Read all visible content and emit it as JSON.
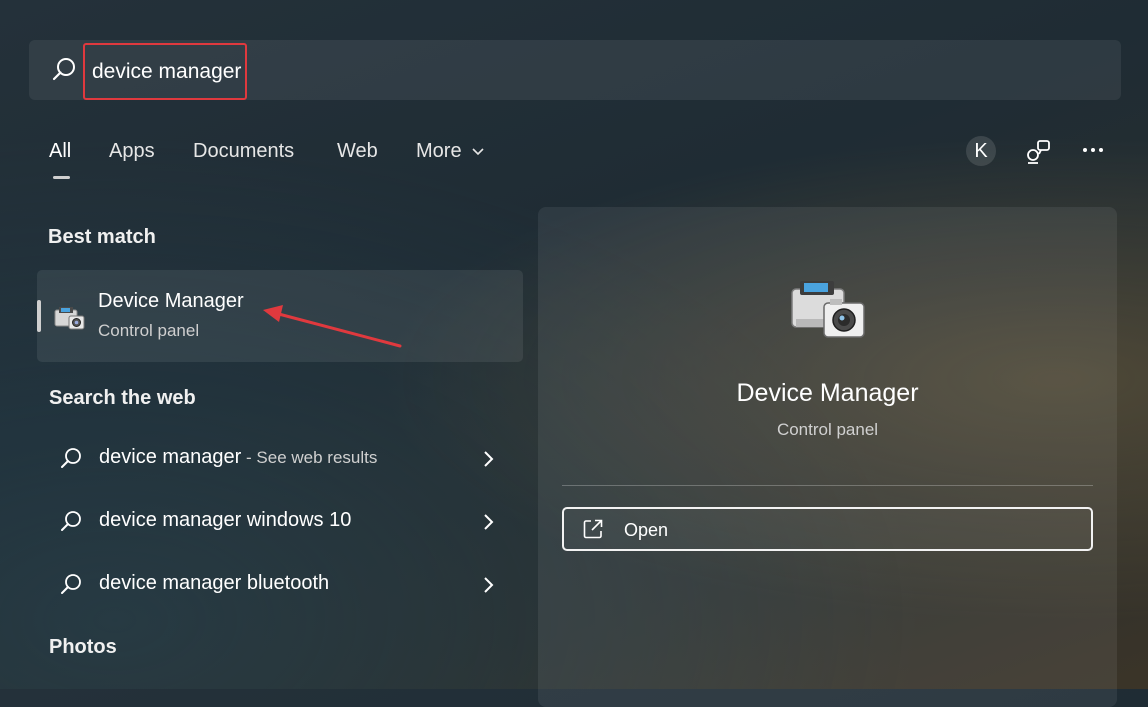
{
  "search": {
    "value": "device manager",
    "placeholder": ""
  },
  "tabs": [
    {
      "label": "All",
      "active": true
    },
    {
      "label": "Apps",
      "active": false
    },
    {
      "label": "Documents",
      "active": false
    },
    {
      "label": "Web",
      "active": false
    },
    {
      "label": "More",
      "active": false
    }
  ],
  "header": {
    "avatar_letter": "K",
    "icons": [
      "search-icon",
      "chevron-down-icon",
      "connected-devices-icon",
      "more-options-icon"
    ]
  },
  "best_match": {
    "section_title": "Best match",
    "title": "Device Manager",
    "subtitle": "Control panel",
    "icon": "device-manager-icon"
  },
  "web_search": {
    "section_title": "Search the web",
    "items": [
      {
        "query": "device manager",
        "suffix": " - See web results"
      },
      {
        "query": "device manager windows 10",
        "suffix": ""
      },
      {
        "query": "device manager bluetooth",
        "suffix": ""
      }
    ]
  },
  "photos": {
    "section_title": "Photos"
  },
  "preview": {
    "title": "Device Manager",
    "subtitle": "Control panel",
    "open_label": "Open",
    "open_icon": "open-external-icon"
  },
  "colors": {
    "highlight_red": "#e0393e",
    "accent_white": "#ffffff"
  }
}
